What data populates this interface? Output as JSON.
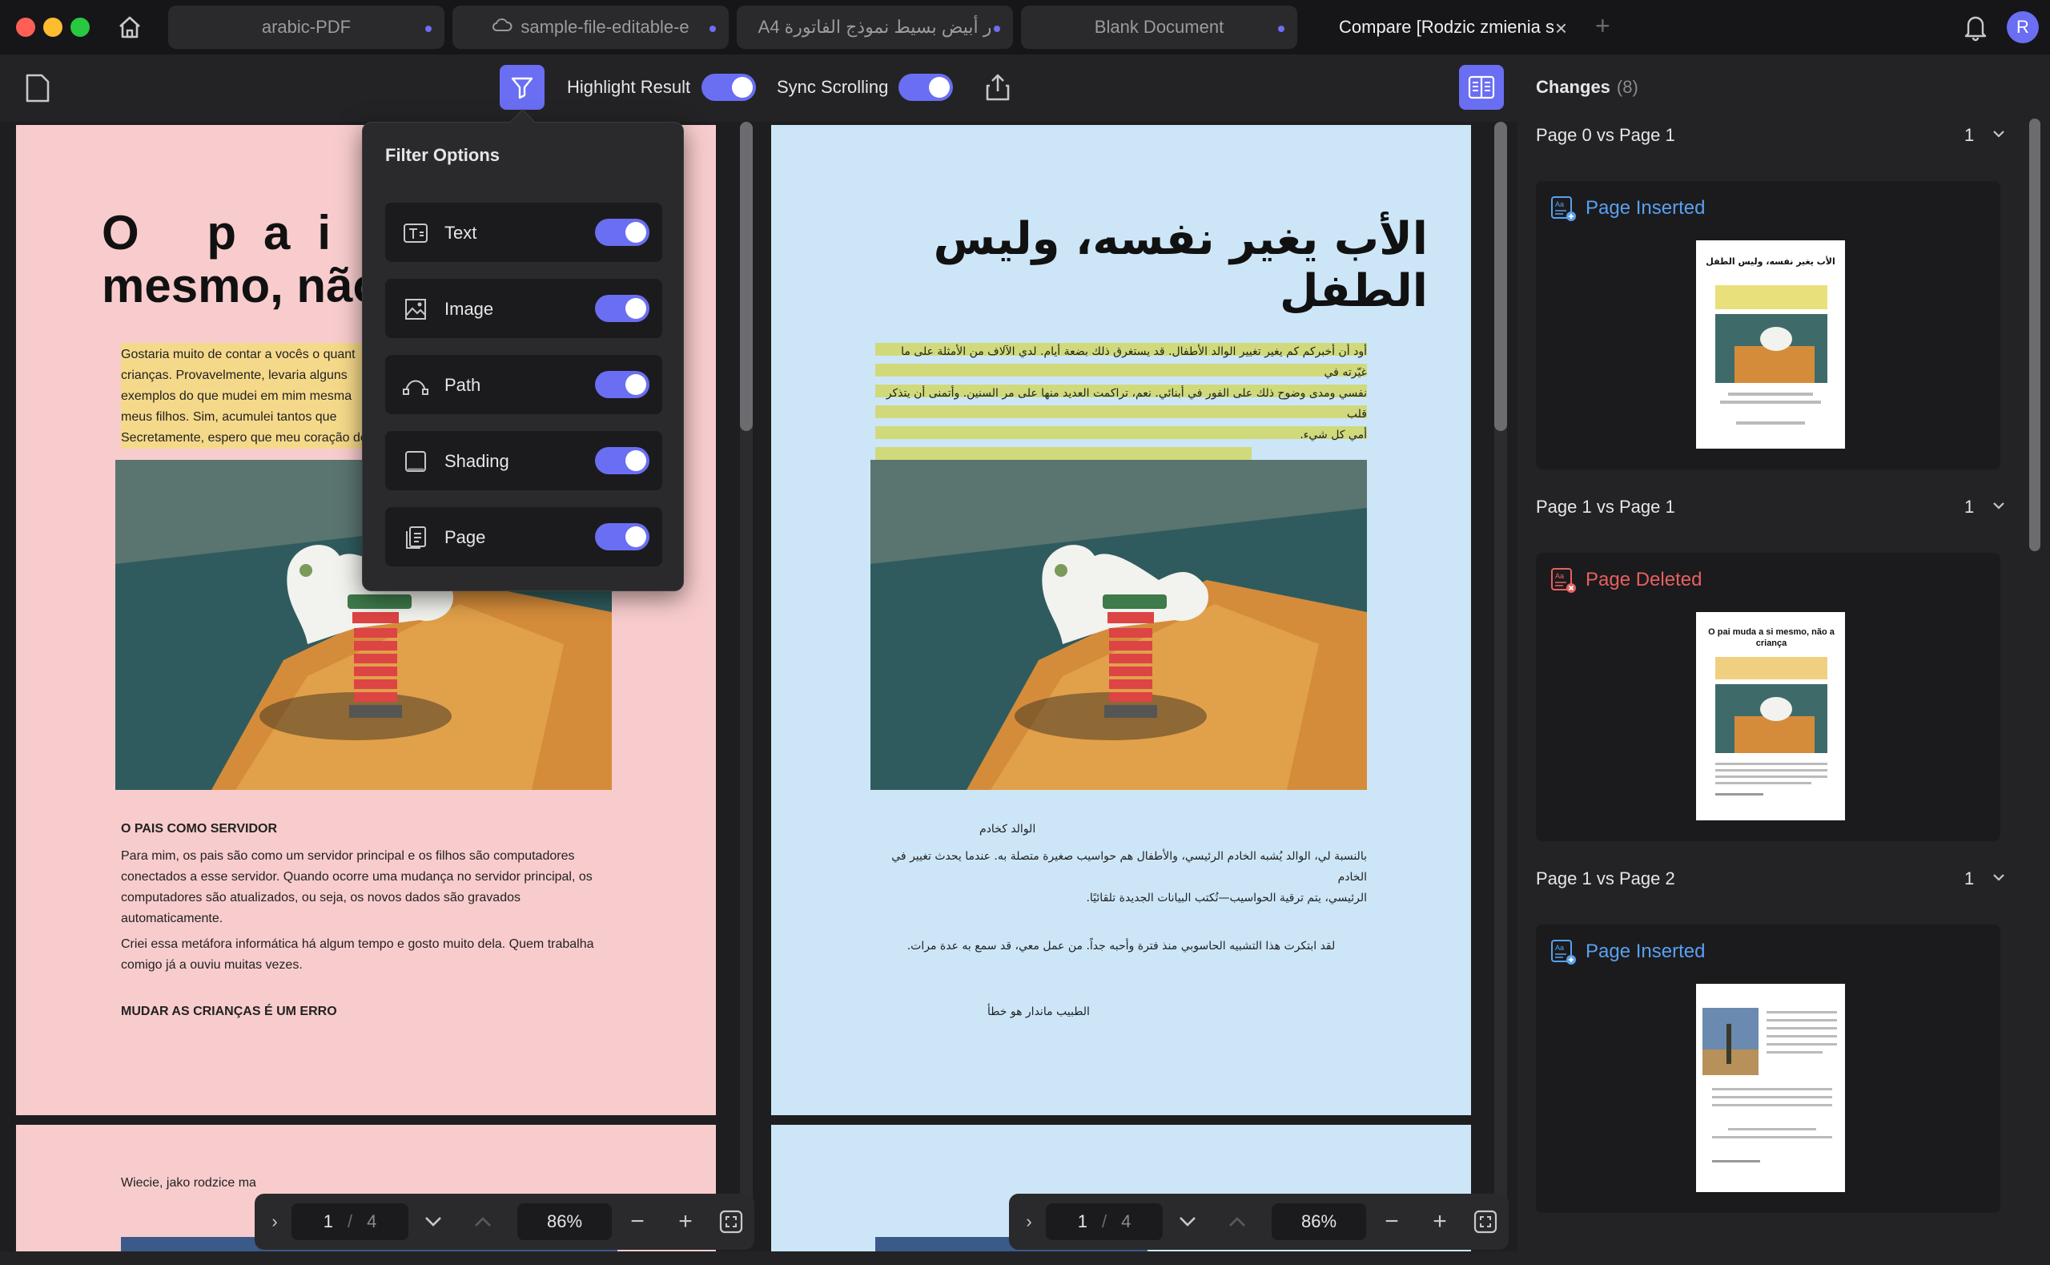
{
  "tabs": [
    {
      "label": "arabic-PDF"
    },
    {
      "label": "sample-file-editable-e"
    },
    {
      "label": "A4 ‏ر أبيض بسيط نموذج الفاتورة"
    },
    {
      "label": "Blank Document"
    },
    {
      "label": "Compare [Rodzic zmienia s"
    }
  ],
  "user": {
    "initial": "R"
  },
  "toolbar": {
    "highlight_label": "Highlight Result",
    "sync_label": "Sync Scrolling"
  },
  "filter": {
    "title": "Filter Options",
    "options": [
      {
        "label": "Text"
      },
      {
        "label": "Image"
      },
      {
        "label": "Path"
      },
      {
        "label": "Shading"
      },
      {
        "label": "Page"
      }
    ]
  },
  "left_doc": {
    "title_line1": "O pai m",
    "title_line2": "mesmo, não",
    "para_lines": [
      "Gostaria muito de contar a vocês o quant",
      "crianças. Provavelmente, levaria alguns",
      "exemplos do que mudei em mim mesma",
      "meus filhos. Sim, acumulei tantos que",
      "Secretamente, espero que meu coração de"
    ],
    "section1": "O PAIS COMO SERVIDOR",
    "section1_body": [
      "Para mim, os pais são como um servidor principal e os filhos são computadores",
      "conectados a esse servidor. Quando ocorre uma mudança no servidor principal, os",
      "computadores são atualizados, ou seja, os novos dados são gravados",
      "automaticamente.",
      "Criei essa metáfora informática há algum tempo e gosto muito dela. Quem trabalha",
      "comigo já a ouviu muitas vezes."
    ],
    "section2": "MUDAR AS CRIANÇAS É UM ERRO",
    "next_page_text": "Wiecie, jako rodzice ma"
  },
  "right_doc": {
    "title": "الأب يغير نفسه، وليس الطفل",
    "para_lines": [
      "أود أن أخبركم كم يغير تغيير الوالد الأطفال. قد يستغرق ذلك بضعة أيام. لدي الآلاف من الأمثلة على ما غيّرته في",
      "نفسي ومدى وضوح ذلك على الفور في أبنائي. نعم، تراكمت العديد منها على مر السنين. وأتمنى أن يتذكر قلب",
      "أمي كل شيء."
    ],
    "section1": "الوالد كخادم",
    "section1_body": [
      "بالنسبة لي، الوالد يُشبه الخادم الرئيسي، والأطفال هم حواسيب صغيرة متصلة به. عندما يحدث تغيير في الخادم",
      "الرئيسي، يتم ترقية الحواسيب—تُكتب البيانات الجديدة تلقائيًا."
    ],
    "section1_extra": "لقد ابتكرت هذا التشبيه الحاسوبي منذ فترة وأحبه جداً. من عمل معي، قد سمع به عدة مرات.",
    "section2": "الطبيب ماندار هو خطأ"
  },
  "nav_left": {
    "page": "1",
    "sep": "/",
    "total": "4",
    "zoom": "86%"
  },
  "nav_right": {
    "page": "1",
    "sep": "/",
    "total": "4",
    "zoom": "86%"
  },
  "changes": {
    "title": "Changes",
    "count": "(8)",
    "groups": [
      {
        "head": "Page 0 vs Page 1",
        "count": "1",
        "label": "Page Inserted",
        "color": "#5aa0f0"
      },
      {
        "head": "Page 1 vs Page 1",
        "count": "1",
        "label": "Page Deleted",
        "color": "#e86060"
      },
      {
        "head": "Page 1 vs Page 2",
        "count": "1",
        "label": "Page Inserted",
        "color": "#5aa0f0"
      }
    ],
    "thumb1_title": "الأب يغير نفسه، وليس الطفل",
    "thumb2_title": "O pai muda a si mesmo, não a criança"
  },
  "colors": {
    "accent": "#6a6ef2",
    "left_page": "#f8cccd",
    "right_page": "#cce6f8",
    "inserted": "#5aa0f0",
    "deleted": "#e86060"
  }
}
